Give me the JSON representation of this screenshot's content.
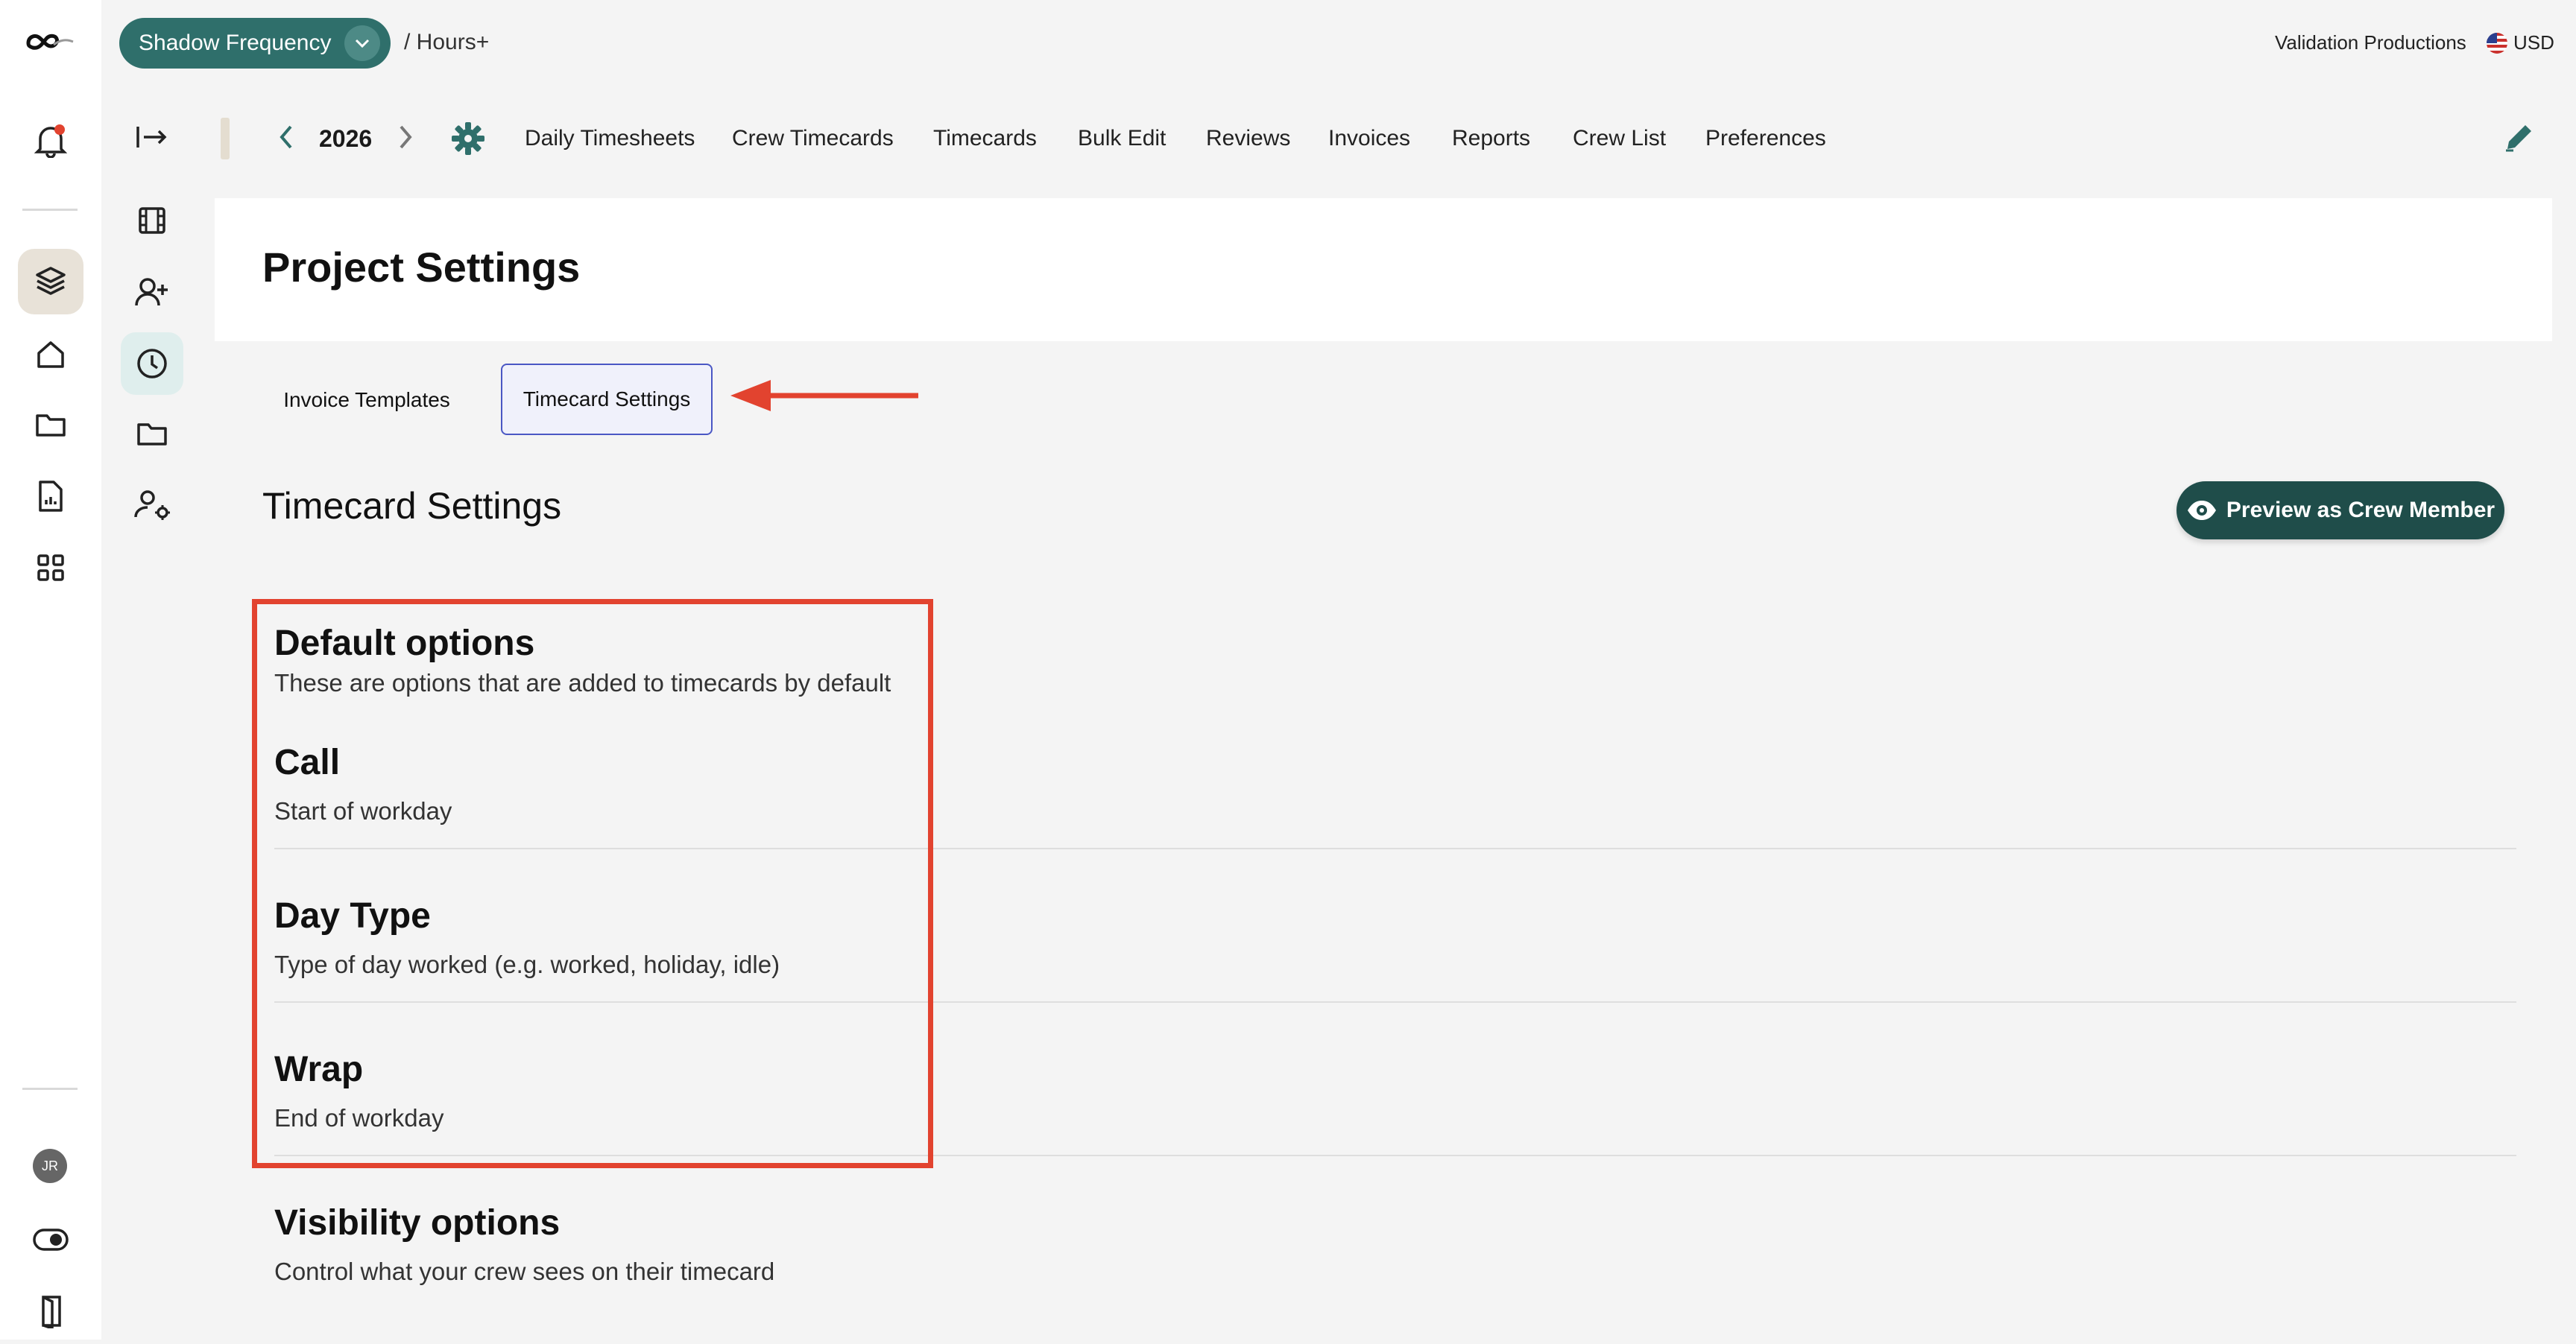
{
  "topbar": {
    "project_name": "Shadow Frequency",
    "breadcrumb": "/ Hours+",
    "company": "Validation Productions",
    "currency": "USD"
  },
  "toolbar": {
    "year": "2026",
    "nav_items": [
      "Daily Timesheets",
      "Crew Timecards",
      "Timecards",
      "Bulk Edit",
      "Reviews",
      "Invoices",
      "Reports",
      "Crew List",
      "Preferences"
    ]
  },
  "page": {
    "title": "Project Settings",
    "tabs": [
      "Invoice Templates",
      "Timecard Settings"
    ],
    "active_tab": "Timecard Settings",
    "section_title": "Timecard Settings",
    "preview_button": "Preview as Crew Member"
  },
  "default_options": {
    "heading": "Default options",
    "description": "These are options that are added to timecards by default",
    "items": [
      {
        "name": "Call",
        "description": "Start of workday"
      },
      {
        "name": "Day Type",
        "description": "Type of day worked (e.g. worked, holiday, idle)"
      },
      {
        "name": "Wrap",
        "description": "End of workday"
      }
    ]
  },
  "visibility_options": {
    "heading": "Visibility options",
    "description": "Control what your crew sees on their timecard"
  },
  "user": {
    "initials": "JR"
  },
  "colors": {
    "brand": "#2f6f6b",
    "annotation": "#e2432f",
    "active_tab_border": "#4a57c4"
  },
  "icons": [
    "logo-icon",
    "bell-icon",
    "layers-icon",
    "home-icon",
    "folder-icon",
    "report-icon",
    "grid-icon",
    "toggle-icon",
    "door-icon",
    "collapse-icon",
    "film-icon",
    "add-user-icon",
    "clock-icon",
    "users-gear-icon",
    "gear-icon",
    "edit-icon",
    "eye-icon",
    "flag-icon"
  ]
}
